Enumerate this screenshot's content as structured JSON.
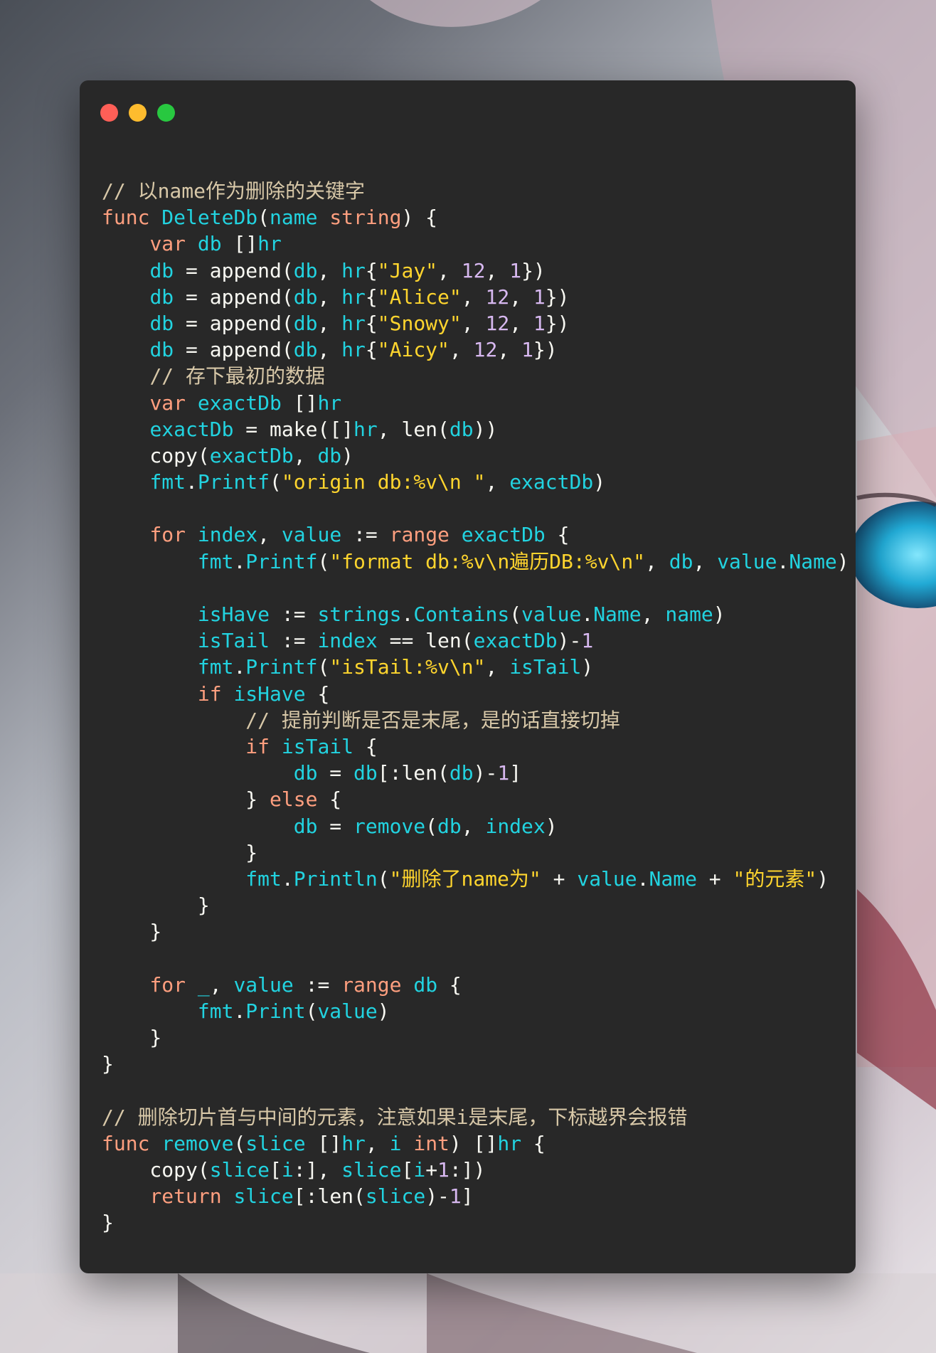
{
  "window": {
    "traffic_lights": [
      "close",
      "minimize",
      "zoom"
    ],
    "colors": {
      "background": "#282828",
      "close": "#ff5f57",
      "minimize": "#febc2e",
      "zoom": "#28c840"
    }
  },
  "syntax_colors": {
    "comment": "#d8c8a8",
    "keyword": "#ff9f7f",
    "ident": "#22d3e0",
    "string": "#ffd52e",
    "number": "#d7b8f0",
    "default": "#f8f8f2"
  },
  "code": [
    [
      [
        "comment",
        "// 以name作为删除的关键字"
      ]
    ],
    [
      [
        "keyword",
        "func "
      ],
      [
        "func",
        "DeleteDb"
      ],
      [
        "default",
        "("
      ],
      [
        "ident",
        "name "
      ],
      [
        "type",
        "string"
      ],
      [
        "default",
        ") {"
      ]
    ],
    [
      [
        "default",
        "    "
      ],
      [
        "keyword",
        "var "
      ],
      [
        "ident",
        "db "
      ],
      [
        "default",
        "[]"
      ],
      [
        "ident",
        "hr"
      ]
    ],
    [
      [
        "default",
        "    "
      ],
      [
        "ident",
        "db"
      ],
      [
        "default",
        " = append("
      ],
      [
        "ident",
        "db"
      ],
      [
        "default",
        ", "
      ],
      [
        "ident",
        "hr"
      ],
      [
        "default",
        "{"
      ],
      [
        "string",
        "\"Jay\""
      ],
      [
        "default",
        ", "
      ],
      [
        "number",
        "12"
      ],
      [
        "default",
        ", "
      ],
      [
        "number",
        "1"
      ],
      [
        "default",
        "})"
      ]
    ],
    [
      [
        "default",
        "    "
      ],
      [
        "ident",
        "db"
      ],
      [
        "default",
        " = append("
      ],
      [
        "ident",
        "db"
      ],
      [
        "default",
        ", "
      ],
      [
        "ident",
        "hr"
      ],
      [
        "default",
        "{"
      ],
      [
        "string",
        "\"Alice\""
      ],
      [
        "default",
        ", "
      ],
      [
        "number",
        "12"
      ],
      [
        "default",
        ", "
      ],
      [
        "number",
        "1"
      ],
      [
        "default",
        "})"
      ]
    ],
    [
      [
        "default",
        "    "
      ],
      [
        "ident",
        "db"
      ],
      [
        "default",
        " = append("
      ],
      [
        "ident",
        "db"
      ],
      [
        "default",
        ", "
      ],
      [
        "ident",
        "hr"
      ],
      [
        "default",
        "{"
      ],
      [
        "string",
        "\"Snowy\""
      ],
      [
        "default",
        ", "
      ],
      [
        "number",
        "12"
      ],
      [
        "default",
        ", "
      ],
      [
        "number",
        "1"
      ],
      [
        "default",
        "})"
      ]
    ],
    [
      [
        "default",
        "    "
      ],
      [
        "ident",
        "db"
      ],
      [
        "default",
        " = append("
      ],
      [
        "ident",
        "db"
      ],
      [
        "default",
        ", "
      ],
      [
        "ident",
        "hr"
      ],
      [
        "default",
        "{"
      ],
      [
        "string",
        "\"Aicy\""
      ],
      [
        "default",
        ", "
      ],
      [
        "number",
        "12"
      ],
      [
        "default",
        ", "
      ],
      [
        "number",
        "1"
      ],
      [
        "default",
        "})"
      ]
    ],
    [
      [
        "default",
        "    "
      ],
      [
        "comment",
        "// 存下最初的数据"
      ]
    ],
    [
      [
        "default",
        "    "
      ],
      [
        "keyword",
        "var "
      ],
      [
        "ident",
        "exactDb "
      ],
      [
        "default",
        "[]"
      ],
      [
        "ident",
        "hr"
      ]
    ],
    [
      [
        "default",
        "    "
      ],
      [
        "ident",
        "exactDb"
      ],
      [
        "default",
        " = make([]"
      ],
      [
        "ident",
        "hr"
      ],
      [
        "default",
        ", len("
      ],
      [
        "ident",
        "db"
      ],
      [
        "default",
        "))"
      ]
    ],
    [
      [
        "default",
        "    copy("
      ],
      [
        "ident",
        "exactDb"
      ],
      [
        "default",
        ", "
      ],
      [
        "ident",
        "db"
      ],
      [
        "default",
        ")"
      ]
    ],
    [
      [
        "default",
        "    "
      ],
      [
        "ident",
        "fmt"
      ],
      [
        "default",
        "."
      ],
      [
        "func",
        "Printf"
      ],
      [
        "default",
        "("
      ],
      [
        "string",
        "\"origin db:%v\\n \""
      ],
      [
        "default",
        ", "
      ],
      [
        "ident",
        "exactDb"
      ],
      [
        "default",
        ")"
      ]
    ],
    [
      [
        "default",
        ""
      ]
    ],
    [
      [
        "default",
        "    "
      ],
      [
        "keyword",
        "for "
      ],
      [
        "ident",
        "index"
      ],
      [
        "default",
        ", "
      ],
      [
        "ident",
        "value"
      ],
      [
        "default",
        " := "
      ],
      [
        "keyword",
        "range "
      ],
      [
        "ident",
        "exactDb"
      ],
      [
        "default",
        " {"
      ]
    ],
    [
      [
        "default",
        "        "
      ],
      [
        "ident",
        "fmt"
      ],
      [
        "default",
        "."
      ],
      [
        "func",
        "Printf"
      ],
      [
        "default",
        "("
      ],
      [
        "string",
        "\"format db:%v\\n遍历DB:%v\\n\""
      ],
      [
        "default",
        ", "
      ],
      [
        "ident",
        "db"
      ],
      [
        "default",
        ", "
      ],
      [
        "ident",
        "value"
      ],
      [
        "default",
        "."
      ],
      [
        "ident",
        "Name"
      ],
      [
        "default",
        ")"
      ]
    ],
    [
      [
        "default",
        ""
      ]
    ],
    [
      [
        "default",
        "        "
      ],
      [
        "ident",
        "isHave"
      ],
      [
        "default",
        " := "
      ],
      [
        "ident",
        "strings"
      ],
      [
        "default",
        "."
      ],
      [
        "func",
        "Contains"
      ],
      [
        "default",
        "("
      ],
      [
        "ident",
        "value"
      ],
      [
        "default",
        "."
      ],
      [
        "ident",
        "Name"
      ],
      [
        "default",
        ", "
      ],
      [
        "ident",
        "name"
      ],
      [
        "default",
        ")"
      ]
    ],
    [
      [
        "default",
        "        "
      ],
      [
        "ident",
        "isTail"
      ],
      [
        "default",
        " := "
      ],
      [
        "ident",
        "index"
      ],
      [
        "default",
        " == len("
      ],
      [
        "ident",
        "exactDb"
      ],
      [
        "default",
        ")-"
      ],
      [
        "number",
        "1"
      ]
    ],
    [
      [
        "default",
        "        "
      ],
      [
        "ident",
        "fmt"
      ],
      [
        "default",
        "."
      ],
      [
        "func",
        "Printf"
      ],
      [
        "default",
        "("
      ],
      [
        "string",
        "\"isTail:%v\\n\""
      ],
      [
        "default",
        ", "
      ],
      [
        "ident",
        "isTail"
      ],
      [
        "default",
        ")"
      ]
    ],
    [
      [
        "default",
        "        "
      ],
      [
        "keyword",
        "if "
      ],
      [
        "ident",
        "isHave"
      ],
      [
        "default",
        " {"
      ]
    ],
    [
      [
        "default",
        "            "
      ],
      [
        "comment",
        "// 提前判断是否是末尾，是的话直接切掉"
      ]
    ],
    [
      [
        "default",
        "            "
      ],
      [
        "keyword",
        "if "
      ],
      [
        "ident",
        "isTail"
      ],
      [
        "default",
        " {"
      ]
    ],
    [
      [
        "default",
        "                "
      ],
      [
        "ident",
        "db"
      ],
      [
        "default",
        " = "
      ],
      [
        "ident",
        "db"
      ],
      [
        "default",
        "[:len("
      ],
      [
        "ident",
        "db"
      ],
      [
        "default",
        ")-"
      ],
      [
        "number",
        "1"
      ],
      [
        "default",
        "]"
      ]
    ],
    [
      [
        "default",
        "            } "
      ],
      [
        "keyword",
        "else"
      ],
      [
        "default",
        " {"
      ]
    ],
    [
      [
        "default",
        "                "
      ],
      [
        "ident",
        "db"
      ],
      [
        "default",
        " = "
      ],
      [
        "func",
        "remove"
      ],
      [
        "default",
        "("
      ],
      [
        "ident",
        "db"
      ],
      [
        "default",
        ", "
      ],
      [
        "ident",
        "index"
      ],
      [
        "default",
        ")"
      ]
    ],
    [
      [
        "default",
        "            }"
      ]
    ],
    [
      [
        "default",
        "            "
      ],
      [
        "ident",
        "fmt"
      ],
      [
        "default",
        "."
      ],
      [
        "func",
        "Println"
      ],
      [
        "default",
        "("
      ],
      [
        "string",
        "\"删除了name为\""
      ],
      [
        "default",
        " + "
      ],
      [
        "ident",
        "value"
      ],
      [
        "default",
        "."
      ],
      [
        "ident",
        "Name"
      ],
      [
        "default",
        " + "
      ],
      [
        "string",
        "\"的元素\""
      ],
      [
        "default",
        ")"
      ]
    ],
    [
      [
        "default",
        "        }"
      ]
    ],
    [
      [
        "default",
        "    }"
      ]
    ],
    [
      [
        "default",
        ""
      ]
    ],
    [
      [
        "default",
        "    "
      ],
      [
        "keyword",
        "for "
      ],
      [
        "ident",
        "_"
      ],
      [
        "default",
        ", "
      ],
      [
        "ident",
        "value"
      ],
      [
        "default",
        " := "
      ],
      [
        "keyword",
        "range "
      ],
      [
        "ident",
        "db"
      ],
      [
        "default",
        " {"
      ]
    ],
    [
      [
        "default",
        "        "
      ],
      [
        "ident",
        "fmt"
      ],
      [
        "default",
        "."
      ],
      [
        "func",
        "Print"
      ],
      [
        "default",
        "("
      ],
      [
        "ident",
        "value"
      ],
      [
        "default",
        ")"
      ]
    ],
    [
      [
        "default",
        "    }"
      ]
    ],
    [
      [
        "default",
        "}"
      ]
    ],
    [
      [
        "default",
        ""
      ]
    ],
    [
      [
        "comment",
        "// 删除切片首与中间的元素，注意如果i是末尾，下标越界会报错"
      ]
    ],
    [
      [
        "keyword",
        "func "
      ],
      [
        "func",
        "remove"
      ],
      [
        "default",
        "("
      ],
      [
        "ident",
        "slice "
      ],
      [
        "default",
        "[]"
      ],
      [
        "ident",
        "hr"
      ],
      [
        "default",
        ", "
      ],
      [
        "ident",
        "i "
      ],
      [
        "type",
        "int"
      ],
      [
        "default",
        ") []"
      ],
      [
        "ident",
        "hr"
      ],
      [
        "default",
        " {"
      ]
    ],
    [
      [
        "default",
        "    copy("
      ],
      [
        "ident",
        "slice"
      ],
      [
        "default",
        "["
      ],
      [
        "ident",
        "i"
      ],
      [
        "default",
        ":], "
      ],
      [
        "ident",
        "slice"
      ],
      [
        "default",
        "["
      ],
      [
        "ident",
        "i"
      ],
      [
        "default",
        "+"
      ],
      [
        "number",
        "1"
      ],
      [
        "default",
        ":])"
      ]
    ],
    [
      [
        "default",
        "    "
      ],
      [
        "keyword",
        "return "
      ],
      [
        "ident",
        "slice"
      ],
      [
        "default",
        "[:len("
      ],
      [
        "ident",
        "slice"
      ],
      [
        "default",
        ")-"
      ],
      [
        "number",
        "1"
      ],
      [
        "default",
        "]"
      ]
    ],
    [
      [
        "default",
        "}"
      ]
    ]
  ]
}
